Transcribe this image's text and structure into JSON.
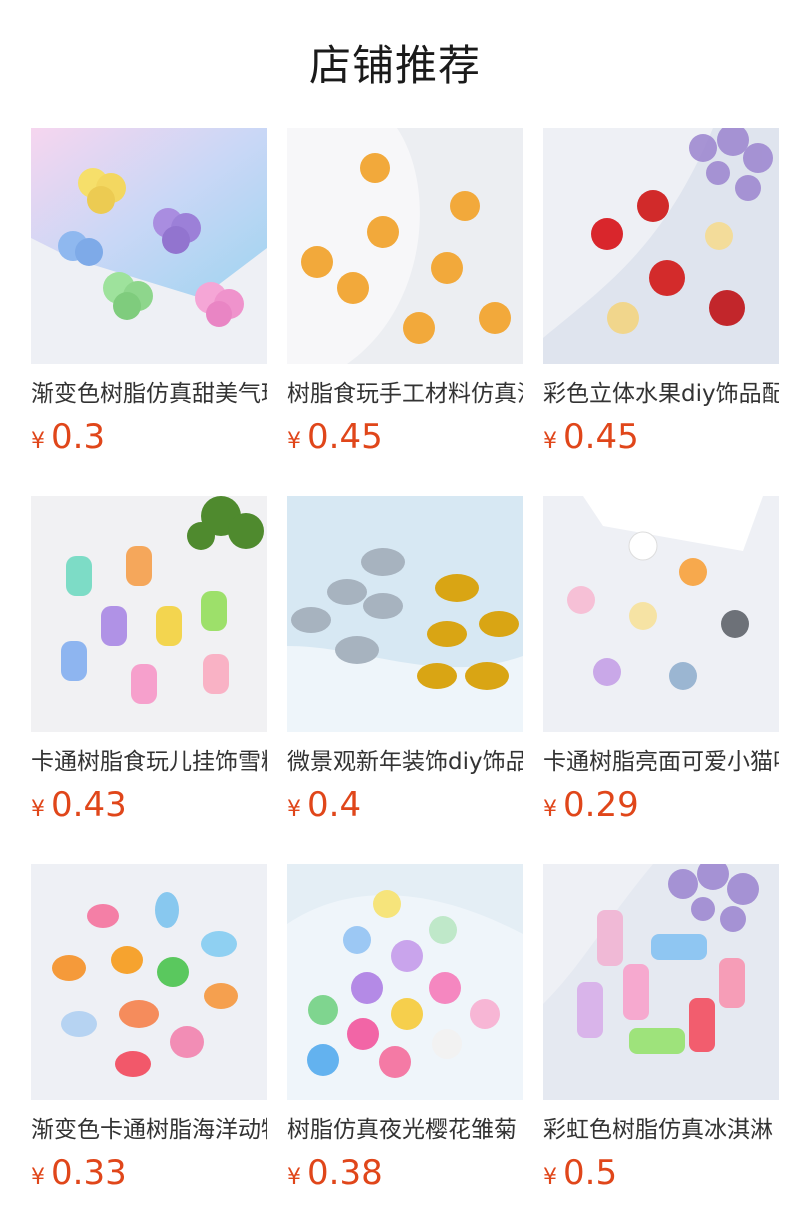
{
  "header": {
    "title": "店铺推荐"
  },
  "products": [
    {
      "title": "渐变色树脂仿真甜美气球",
      "currency": "¥",
      "price": "0.3"
    },
    {
      "title": "树脂食玩手工材料仿真汉堡",
      "currency": "¥",
      "price": "0.45"
    },
    {
      "title": "彩色立体水果diy饰品配件",
      "currency": "¥",
      "price": "0.45"
    },
    {
      "title": "卡通树脂食玩儿挂饰雪糕",
      "currency": "¥",
      "price": "0.43"
    },
    {
      "title": "微景观新年装饰diy饰品",
      "currency": "¥",
      "price": "0.4"
    },
    {
      "title": "卡通树脂亮面可爱小猫咪",
      "currency": "¥",
      "price": "0.29"
    },
    {
      "title": "渐变色卡通树脂海洋动物",
      "currency": "¥",
      "price": "0.33"
    },
    {
      "title": "树脂仿真夜光樱花雏菊",
      "currency": "¥",
      "price": "0.38"
    },
    {
      "title": "彩虹色树脂仿真冰淇淋",
      "currency": "¥",
      "price": "0.5"
    }
  ],
  "colors": {
    "price": "#e0461a",
    "title": "#333333"
  }
}
